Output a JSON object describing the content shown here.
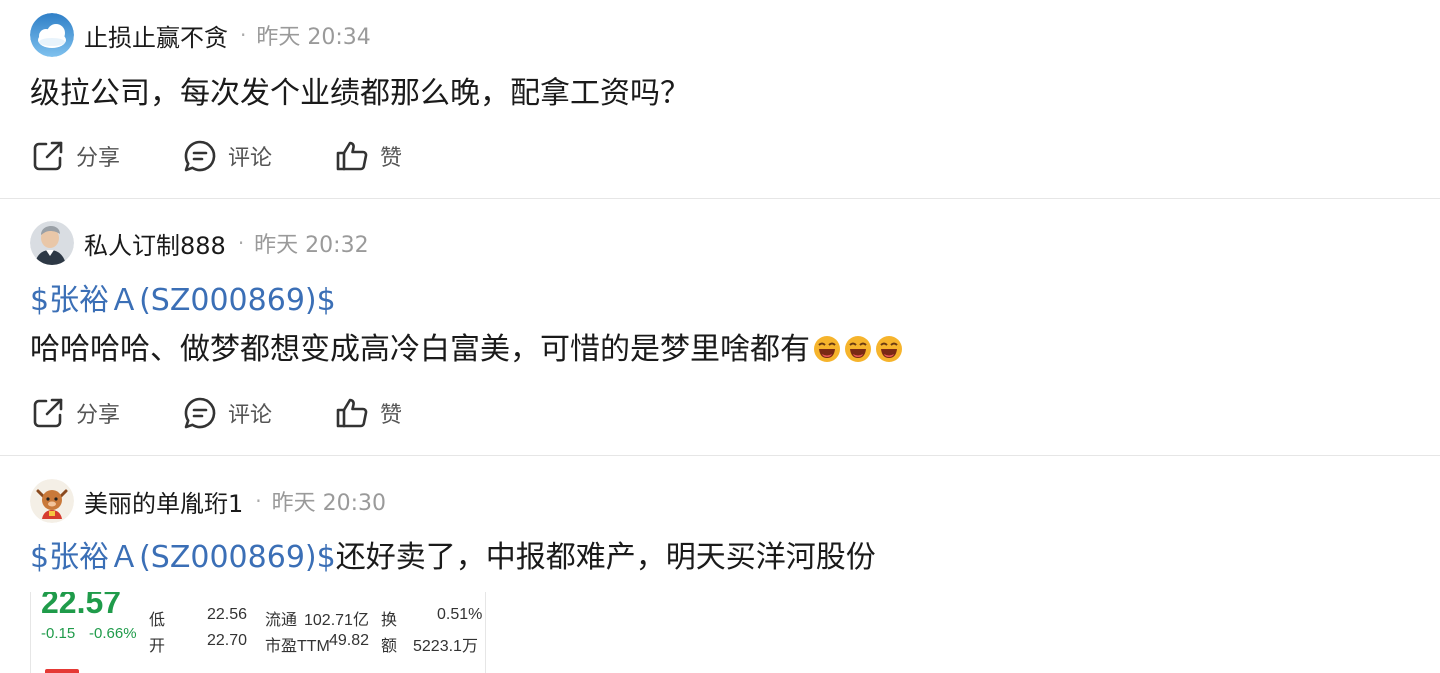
{
  "posts": [
    {
      "username": "止损止赢不贪",
      "time": "昨天 20:34",
      "text": "级拉公司，每次发个业绩都那么晚，配拿工资吗？"
    },
    {
      "username": "私人订制888",
      "time": "昨天 20:32",
      "stock_link": "$张裕Ａ(SZ000869)$",
      "text": "哈哈哈哈、做梦都想变成高冷白富美，可惜的是梦里啥都有"
    },
    {
      "username": "美丽的单胤珩1",
      "time": "昨天 20:30",
      "stock_link": "$张裕Ａ(SZ000869)$",
      "text": "还好卖了，中报都难产，明天买洋河股份"
    }
  ],
  "actions": {
    "share": "分享",
    "comment": "评论",
    "like": "赞"
  },
  "separator_dot": "·",
  "quote_card": {
    "price": "22.57",
    "change": "-0.15",
    "change_pct": "-0.66%",
    "low_label": "低",
    "low": "22.56",
    "open_label": "开",
    "open": "22.70",
    "float_label": "流通",
    "float_value": "102.71亿",
    "pe_label": "市盈TTM",
    "pe_value": "49.82",
    "turnover_label": "换",
    "turnover_value": "0.51%",
    "amount_label": "额",
    "amount_value": "5223.1万"
  },
  "colors": {
    "link": "#3b6fb6",
    "down": "#1f9b4a",
    "separator": "#e6e6e6"
  },
  "icons": [
    "share-icon",
    "comment-icon",
    "like-icon",
    "laughing-emoji"
  ]
}
